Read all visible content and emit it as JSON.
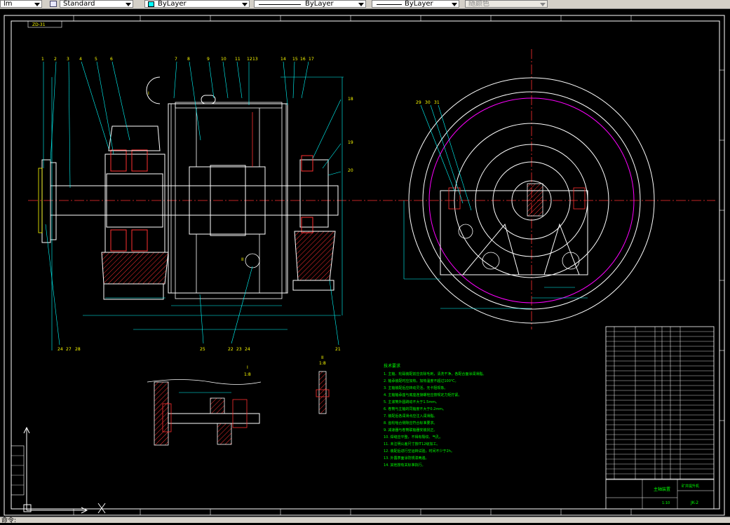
{
  "toolbar": {
    "layer_combo": "lm",
    "textstyle_combo": "Standard",
    "color_combo": "ByLayer",
    "linetype_combo": "ByLayer",
    "lineweight_combo": "ByLayer",
    "plotstyle_combo": "随颜色"
  },
  "drawing": {
    "stamp": "ZD-31",
    "view_label_1": "I",
    "view_label_2": "II",
    "detail_title": "I",
    "detail_scale": "1:8",
    "section_title": "II",
    "section_scale": "1:8",
    "balloons_top": [
      "1",
      "2",
      "3",
      "4",
      "5",
      "6",
      "7",
      "8",
      "9",
      "10",
      "11",
      "12",
      "13",
      "14",
      "15",
      "16",
      "17"
    ],
    "balloons_right": [
      "18",
      "19",
      "20"
    ],
    "balloons_bottom": [
      "24",
      "27",
      "28",
      "25",
      "26",
      "22",
      "23",
      "21"
    ],
    "balloons_side": [
      "29",
      "30",
      "31"
    ]
  },
  "notes": {
    "title": "技术要求",
    "lines": [
      "1. 主轴、轮毂装配前应去除毛刺，清洗干净，各配合面涂润滑脂。",
      "2. 轴承装配时应加热，加热温度不超过100℃。",
      "3. 主轴装配后应转动灵活，无卡阻现象。",
      "4. 主轴轴承座与底座连接螺栓应按规定力矩拧紧。",
      "5. 主滚筒外圆跳动不大于1.5mm。",
      "6. 卷筒与主轴的同轴度不大于0.2mm。",
      "7. 装配后各润滑点应注入润滑脂。",
      "8. 齿轮啮合侧隙应符合标准要求。",
      "9. 减速器与卷筒联轴器安装找正。",
      "10. 焊缝应平整，不得有裂纹、气孔。",
      "11. 未注明公差尺寸按IT12级加工。",
      "12. 装配后进行空运转试验，时间不少于2h。",
      "13. 外露表面涂防锈漆两遍。",
      "14. 其他按有关标准执行。"
    ]
  },
  "title_block": {
    "drawing_no": "JK-2",
    "company": "矿井提升机",
    "title": "主轴装置",
    "scale": "1:10"
  },
  "status": {
    "command": "命令:"
  }
}
